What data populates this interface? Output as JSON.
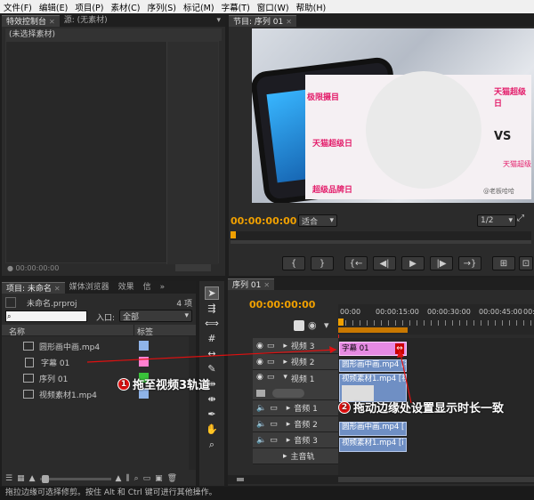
{
  "menubar": [
    "文件(F)",
    "编辑(E)",
    "项目(P)",
    "素材(C)",
    "序列(S)",
    "标记(M)",
    "字幕(T)",
    "窗口(W)",
    "帮助(H)"
  ],
  "effect_controls": {
    "tab_label": "特效控制台",
    "source_tab_label": "源: (无素材)",
    "no_clip_text": "(未选择素材)",
    "timecode": "00:00:00:00"
  },
  "program": {
    "tab_label": "节目: 序列 01",
    "timecode": "00:00:00:00",
    "fit_label": "适合",
    "ratio_label": "1/2",
    "image_text": {
      "brand_top_left": "极限摄目",
      "brand_top_right": "天猫超级日",
      "brand_mid": "天猫超级日",
      "brand_bottom": "超级品牌日",
      "vs": "VS",
      "tmall": "天猫超级",
      "watermark": "@老板哈哈"
    }
  },
  "project": {
    "tab_label": "项目: 未命名",
    "media_browser_tab": "媒体浏览器",
    "effects_tab": "效果",
    "info_tab": "信",
    "project_file": "未命名.prproj",
    "item_count": "4 项",
    "search_placeholder": "",
    "in_label": "入口:",
    "in_value": "全部",
    "col_name": "名称",
    "col_label": "标签",
    "items": [
      {
        "name": "圆形画中画.mp4",
        "color": "#8fb4e8"
      },
      {
        "name": "字幕 01",
        "color": "#ff80d0"
      },
      {
        "name": "序列 01",
        "color": "#39c13a"
      },
      {
        "name": "视频素材1.mp4",
        "color": "#8fb4e8"
      }
    ]
  },
  "sequence": {
    "tab_label": "序列 01",
    "timecode": "00:00:00:00",
    "ruler": [
      "00:00",
      "00:00:15:00",
      "00:00:30:00",
      "00:00:45:00",
      "00:0"
    ],
    "tracks": [
      {
        "name": "视频 3"
      },
      {
        "name": "视频 2"
      },
      {
        "name": "视频 1"
      },
      {
        "name": "音频 1"
      },
      {
        "name": "音频 2"
      },
      {
        "name": "音频 3"
      },
      {
        "name": "主音轨"
      }
    ],
    "clips": {
      "v3": "字幕 01",
      "v2": "圆形画中画.mp4 [视",
      "v1": "视频素材1.mp4 [视",
      "a1": "圆形画中画.mp4 [",
      "a2": "视频素材1.mp4 [i"
    }
  },
  "annotations": {
    "a1_num": "1",
    "a1_text": "拖至视频3轨道",
    "a2_num": "2",
    "a2_text": "拖动边缘处设置显示时长一致"
  },
  "status_bar": "拖拉边缘可选择修剪。按住 Alt 和 Ctrl 键可进行其他操作。"
}
